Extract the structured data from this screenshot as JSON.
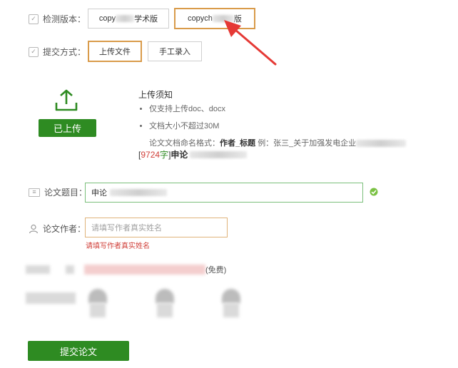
{
  "detect_version": {
    "label": "检测版本：",
    "options": [
      {
        "label_start": "copy",
        "label_end": "学术版",
        "selected": false
      },
      {
        "label_start": "copych",
        "label_end": "版",
        "selected": true
      }
    ]
  },
  "submit_method": {
    "label": "提交方式：",
    "options": [
      {
        "label": "上传文件",
        "selected": true
      },
      {
        "label": "手工录入",
        "selected": false
      }
    ]
  },
  "upload": {
    "icon": "upload-icon",
    "button_label": "已上传",
    "notes_title": "上传须知",
    "notes": [
      "仅支持上传doc、docx",
      "文档大小不超过30M"
    ],
    "naming_prefix": "论文文档命名格式：",
    "naming_bold": "作者_标题",
    "naming_example": "例：张三_关于加强发电企业",
    "word_count": "9724",
    "word_unit": "字",
    "file_name_start": "申论"
  },
  "form": {
    "title_label": "论文题目：",
    "title_value": "申论",
    "author_label": "论文作者：",
    "author_placeholder": "请填写作者真实姓名",
    "author_error": "请填写作者真实姓名"
  },
  "extra": {
    "hint_text": "(免费)"
  },
  "submit_button": "提交论文",
  "colors": {
    "green": "#2e8b22",
    "selected_border": "#d99b4a",
    "error": "#d0403a",
    "arrow": "#e53935"
  }
}
